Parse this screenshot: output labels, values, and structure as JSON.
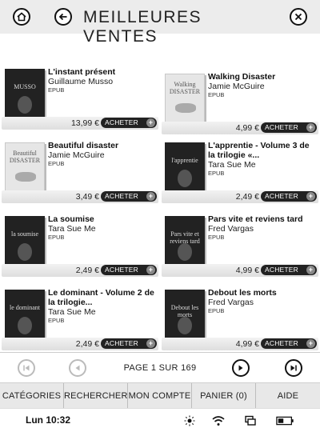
{
  "header": {
    "title": "MEILLEURES VENTES"
  },
  "books": [
    {
      "title": "L'instant présent",
      "author": "Guillaume Musso",
      "format": "EPUB",
      "price": "13,99 €",
      "buy_label": "ACHETER",
      "cover_text": "MUSSO",
      "cover_style": "dark"
    },
    {
      "title": "Walking Disaster",
      "author": "Jamie McGuire",
      "format": "EPUB",
      "price": "4,99 €",
      "buy_label": "ACHETER",
      "cover_text": "Walking DISASTER",
      "cover_style": "light"
    },
    {
      "title": "Beautiful disaster",
      "author": "Jamie McGuire",
      "format": "EPUB",
      "price": "3,49 €",
      "buy_label": "ACHETER",
      "cover_text": "Beautiful DISASTER",
      "cover_style": "light"
    },
    {
      "title": "L'apprentie - Volume 3 de la trilogie «...",
      "author": "Tara Sue Me",
      "format": "EPUB",
      "price": "2,49 €",
      "buy_label": "ACHETER",
      "cover_text": "l'apprentie",
      "cover_style": "dark"
    },
    {
      "title": "La soumise",
      "author": "Tara Sue Me",
      "format": "EPUB",
      "price": "2,49 €",
      "buy_label": "ACHETER",
      "cover_text": "la soumise",
      "cover_style": "dark"
    },
    {
      "title": "Pars vite et reviens tard",
      "author": "Fred Vargas",
      "format": "EPUB",
      "price": "4,99 €",
      "buy_label": "ACHETER",
      "cover_text": "Pars vite et reviens tard",
      "cover_style": "dark"
    },
    {
      "title": "Le dominant - Volume 2 de la trilogie...",
      "author": "Tara Sue Me",
      "format": "EPUB",
      "price": "2,49 €",
      "buy_label": "ACHETER",
      "cover_text": "le dominant",
      "cover_style": "dark"
    },
    {
      "title": "Debout les morts",
      "author": "Fred Vargas",
      "format": "EPUB",
      "price": "4,99 €",
      "buy_label": "ACHETER",
      "cover_text": "Debout les morts",
      "cover_style": "dark"
    }
  ],
  "pagination": {
    "label": "PAGE 1 SUR 169"
  },
  "nav": {
    "categories": "CATÉGORIES",
    "search": "RECHERCHER",
    "account": "MON COMPTE",
    "cart": "PANIER (0)",
    "help": "AIDE"
  },
  "status": {
    "time": "Lun 10:32"
  },
  "icons": {
    "home": "home-icon",
    "back": "back-arrow-icon",
    "close": "close-icon",
    "first_page": "first-page-icon",
    "prev_page": "previous-page-icon",
    "next_page": "next-page-icon",
    "last_page": "last-page-icon",
    "frontlight": "frontlight-icon",
    "wifi": "wifi-icon",
    "sync": "sync-icon",
    "battery": "battery-icon"
  }
}
